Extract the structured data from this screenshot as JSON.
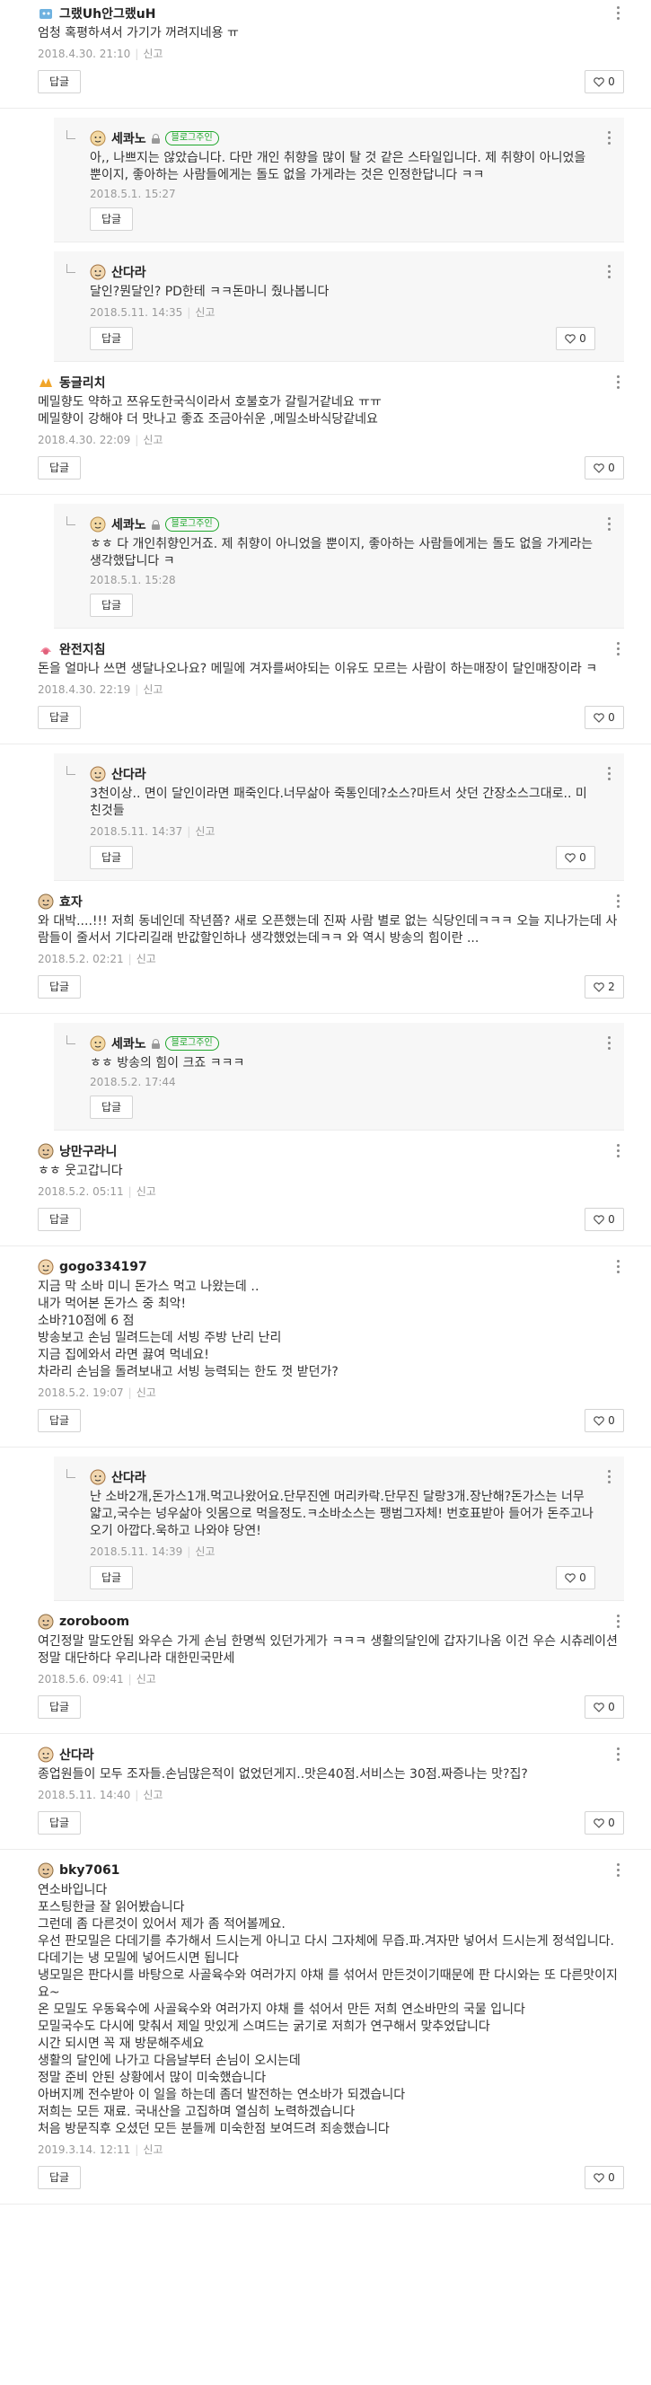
{
  "ui": {
    "reply_label": "답글",
    "report_label": "신고",
    "owner_badge": "블로그주인"
  },
  "comments": [
    {
      "nick": "그랬Uh안그랬uH",
      "body": "엄청 혹평하셔서 가기가 꺼려지네용 ㅠ",
      "date": "2018.4.30. 21:10",
      "likes": "0",
      "replies": [
        {
          "nick": "세콰노",
          "body": "아,, 나쁘지는 않았습니다. 다만 개인 취향을 많이 탈 것 같은 스타일입니다. 제 취향이 아니었을 뿐이지, 좋아하는 사람들에게는 돌도 없을 가게라는 것은 인정한답니다 ㅋㅋ",
          "date": "2018.5.1. 15:27",
          "likes": ""
        },
        {
          "nick": "산다라",
          "body": "달인?뭔달인? PD한테 ㅋㅋ돈마니 줬나봅니다",
          "date": "2018.5.11. 14:35",
          "likes": "0"
        }
      ]
    },
    {
      "nick": "동글리치",
      "body": "메밀향도 약하고 쯔유도한국식이라서 호불호가 갈릴거같네요 ㅠㅠ\n메밀향이 강해야 더 맛나고 좋죠 조금아쉬운 ,메밀소바식당같네요",
      "date": "2018.4.30. 22:09",
      "likes": "0",
      "replies": [
        {
          "nick": "세콰노",
          "body": "ㅎㅎ 다 개인취향인거죠. 제 취향이 아니었을 뿐이지, 좋아하는 사람들에게는 돌도 없을 가게라는 생각했답니다 ㅋ",
          "date": "2018.5.1. 15:28",
          "likes": ""
        }
      ]
    },
    {
      "nick": "완전지침",
      "body": "돈을 얼마나 쓰면 생달나오나요? 메밀에 겨자를써야되는 이유도 모르는 사람이 하는매장이 달인매장이라 ㅋ",
      "date": "2018.4.30. 22:19",
      "likes": "0",
      "replies": [
        {
          "nick": "산다라",
          "body": "3천이상.. 면이 달인이라면 패죽인다.너무삶아 죽통인데?소스?마트서 삿던 간장소스그대로.. 미친것들",
          "date": "2018.5.11. 14:37",
          "likes": "0"
        }
      ]
    },
    {
      "nick": "효자",
      "body": "와 대박....!!! 저희 동네인데 작년쯤? 새로 오픈했는데 진짜 사람 별로 없는 식당인데ㅋㅋㅋ 오늘 지나가는데 사람들이 줄서서 기다리길래 반값할인하나 생각했었는데ㅋㅋ 와 역시 방송의 힘이란 ...",
      "date": "2018.5.2. 02:21",
      "likes": "2",
      "replies": [
        {
          "nick": "세콰노",
          "body": "ㅎㅎ 방송의 힘이 크죠 ㅋㅋㅋ",
          "date": "2018.5.2. 17:44",
          "likes": ""
        }
      ]
    },
    {
      "nick": "낭만구라니",
      "body": "ㅎㅎ 웃고갑니다",
      "date": "2018.5.2. 05:11",
      "likes": "0",
      "replies": []
    },
    {
      "nick": "gogo334197",
      "body": "지금 막 소바 미니 돈가스 먹고 나왔는데 ‥\n내가 먹어본 돈가스 중 최악!\n소바?10점에 6 점\n방송보고 손님 밀려드는데 서빙 주방 난리 난리\n지금 집에와서 라면 끓여 먹네요!\n차라리 손님을 돌려보내고 서빙 능력되는 한도 껏 받던가?",
      "date": "2018.5.2. 19:07",
      "likes": "0",
      "replies": [
        {
          "nick": "산다라",
          "body": "난 소바2개,돈가스1개.먹고나왔어요.단무진엔 머리카락.단무진 달랑3개.장난해?돈가스는 너무얇고,국수는 넝우삶아 잇몸으로 먹을정도.ㅋ소바소스는 팽범그자체! 번호표받아 들어가 돈주고나오기 아깝다.욱하고 나와야 당연!",
          "date": "2018.5.11. 14:39",
          "likes": "0"
        }
      ]
    },
    {
      "nick": "zoroboom",
      "body": "여긴정말 말도안됨 와우슨 가게 손님 한명씩 있던가게가 ㅋㅋㅋ 생활의달인에 갑자기나옴 이건 우슨 시츄레이션\n정말 대단하다 우리나라 대한민국만세",
      "date": "2018.5.6. 09:41",
      "likes": "0",
      "replies": []
    },
    {
      "nick": "산다라",
      "body": "종업원들이 모두 조자들.손님많은적이 없었던게지..맛은40점.서비스는 30점.짜증나는 맛?집?",
      "date": "2018.5.11. 14:40",
      "likes": "0",
      "replies": []
    },
    {
      "nick": "bky7061",
      "body": "연소바입니다\n포스팅한글 잘 읽어봤습니다\n그런데 좀 다른것이 있어서 제가 좀 적어볼께요.\n우선 판모밀은 다데기를 추가해서 드시는게 아니고 다시 그자체에 무즙.파.겨자만 넣어서 드시는게 정석입니다. 다데기는 냉 모밀에 넣어드시면 됩니다\n냉모밀은 판다시를 바탕으로 사골육수와 여러가지 야채 를 섞어서 만든것이기때문에 판 다시와는 또 다른맛이지요~\n온 모밀도 우동육수에 사골육수와 여러가지 야채 를 섞어서 만든 저희 연소바만의 국물 입니다\n모밀국수도 다시에 맞춰서 제일 맛있게 스며드는 굵기로 저희가 연구해서 맞추었답니다\n시간 되시면 꼭 재 방문해주세요\n생활의 달인에 나가고 다음날부터 손님이 오시는데\n정말 준비 안된 상황에서 많이 미숙했습니다\n아버지께 전수받아 이 일을 하는데 좀더 발전하는 연소바가 되겠습니다\n저희는 모든 재료. 국내산을 고집하며 열심히 노력하겠습니다\n처음 방문직후 오셨던 모든 분들께 미숙한점 보여드려 죄송했습니다",
      "date": "2019.3.14. 12:11",
      "likes": "0",
      "replies": []
    }
  ]
}
